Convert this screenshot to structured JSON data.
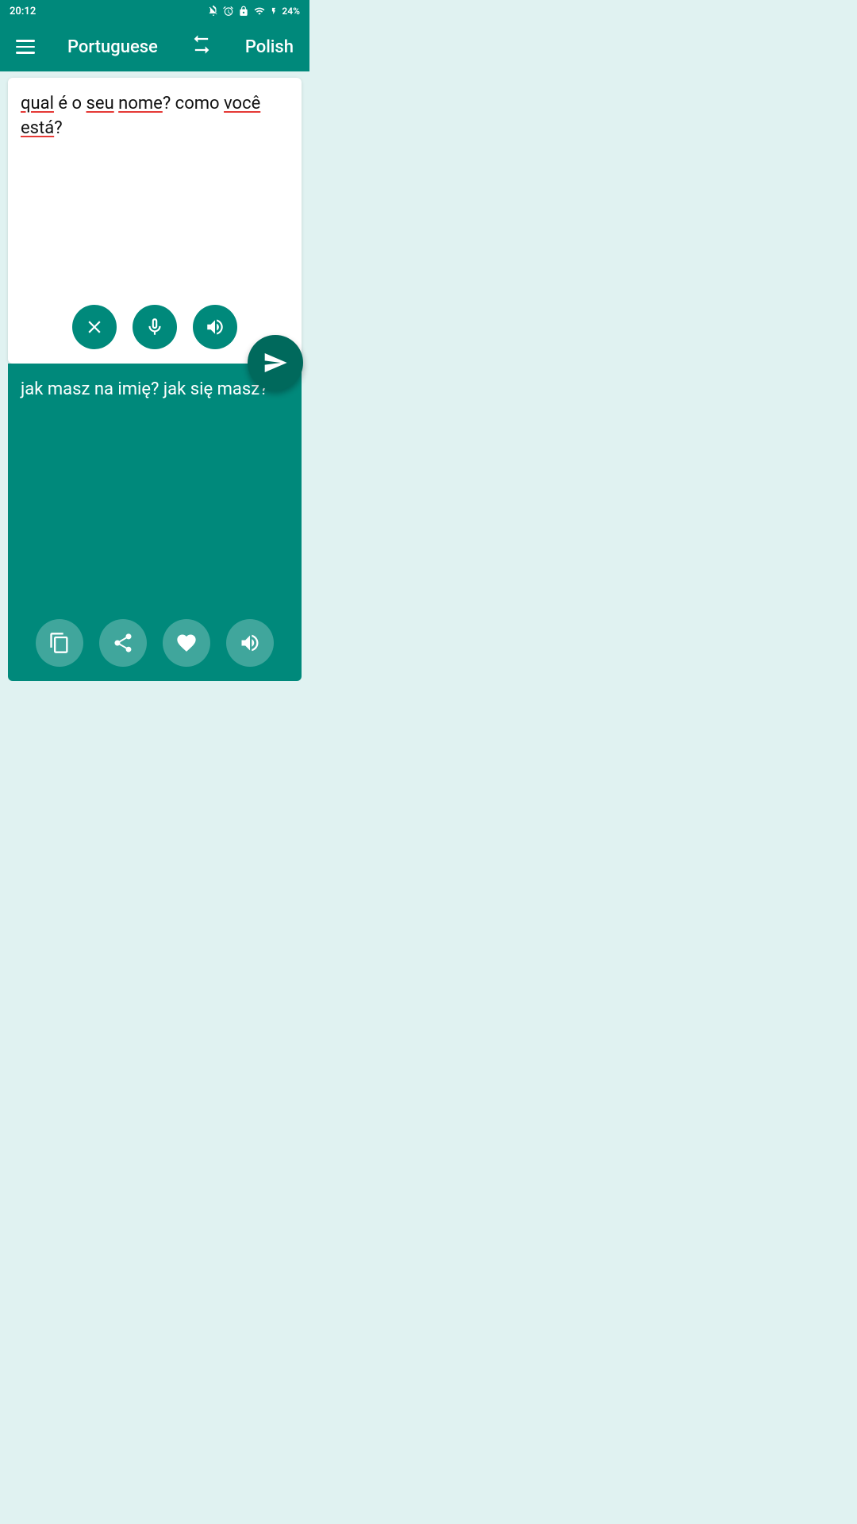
{
  "status_bar": {
    "time": "20:12",
    "battery": "24%"
  },
  "header": {
    "source_lang": "Portuguese",
    "target_lang": "Polish"
  },
  "source": {
    "text_parts": [
      {
        "text": "qual",
        "underline": true
      },
      {
        "text": " é o ",
        "underline": false
      },
      {
        "text": "seu",
        "underline": true
      },
      {
        "text": " ",
        "underline": false
      },
      {
        "text": "nome",
        "underline": true
      },
      {
        "text": "? como ",
        "underline": false
      },
      {
        "text": "você",
        "underline": true
      },
      {
        "text": "\n",
        "underline": false
      },
      {
        "text": "está",
        "underline": true
      },
      {
        "text": "?",
        "underline": false
      }
    ],
    "full_text": "qual é o seu nome? como você está?"
  },
  "translation": {
    "text": "jak masz na imię? jak się masz?"
  },
  "controls": {
    "clear_label": "clear",
    "mic_label": "microphone",
    "speak_source_label": "speak source",
    "translate_label": "translate",
    "copy_label": "copy",
    "share_label": "share",
    "favorite_label": "favorite",
    "speak_translation_label": "speak translation"
  }
}
